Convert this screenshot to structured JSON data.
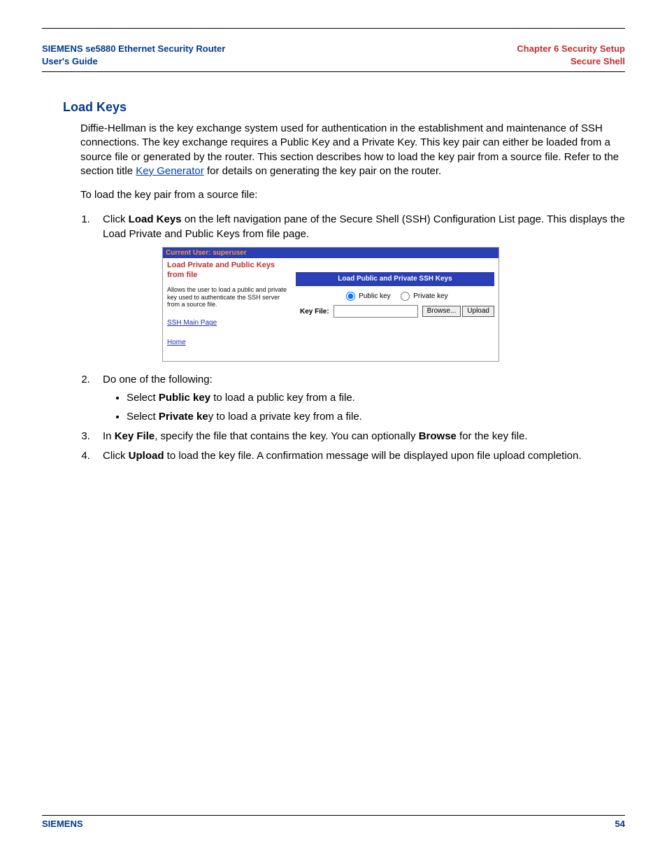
{
  "header": {
    "left_line1": "SIEMENS se5880 Ethernet Security Router",
    "left_line2": "User's Guide",
    "right_line1": "Chapter 6  Security Setup",
    "right_line2": "Secure Shell"
  },
  "section_title": "Load Keys",
  "intro_text_pre": "Diffie-Hellman is the key exchange system used for authentication in the establishment and maintenance of SSH connections. The key exchange requires a Public Key and a Private Key. This key pair can either be loaded from a source file or generated by the router. This section describes how to load the key pair from a source file. Refer to the section title ",
  "intro_link": "Key Generator",
  "intro_text_post": " for details on generating the key pair on the router.",
  "lead_text": "To load the key pair from a source file:",
  "step1_pre": "Click ",
  "step1_bold": "Load Keys",
  "step1_post": " on the left navigation pane of the Secure Shell (SSH) Configuration List page. This displays the Load Private and Public Keys from file page.",
  "screenshot": {
    "current_user": "Current User: superuser",
    "left_title": "Load Private and Public Keys from file",
    "left_desc": "Allows the user to load a public and private key used to authenticate the SSH server from a source file.",
    "link_ssh": "SSH Main Page",
    "link_home": "Home",
    "panel_title": "Load Public and Private SSH Keys",
    "opt_public": "Public key",
    "opt_private": "Private key",
    "key_file_label": "Key File:",
    "browse_btn": "Browse...",
    "upload_btn": "Upload"
  },
  "step2_intro": "Do one of the following:",
  "step2_b1_pre": "Select ",
  "step2_b1_bold": "Public key",
  "step2_b1_post": " to load a public key from a file.",
  "step2_b2_pre": "Select ",
  "step2_b2_bold": "Private ke",
  "step2_b2_post": "y to load a private key from a file.",
  "step3_pre": "In ",
  "step3_bold1": "Key File",
  "step3_mid": ", specify the file that contains the key. You can optionally ",
  "step3_bold2": "Browse",
  "step3_post": " for the key file.",
  "step4_pre": "Click ",
  "step4_bold": "Upload",
  "step4_post": " to load the key file. A confirmation message will be displayed upon file upload completion.",
  "footer": {
    "brand": "SIEMENS",
    "page": "54"
  }
}
